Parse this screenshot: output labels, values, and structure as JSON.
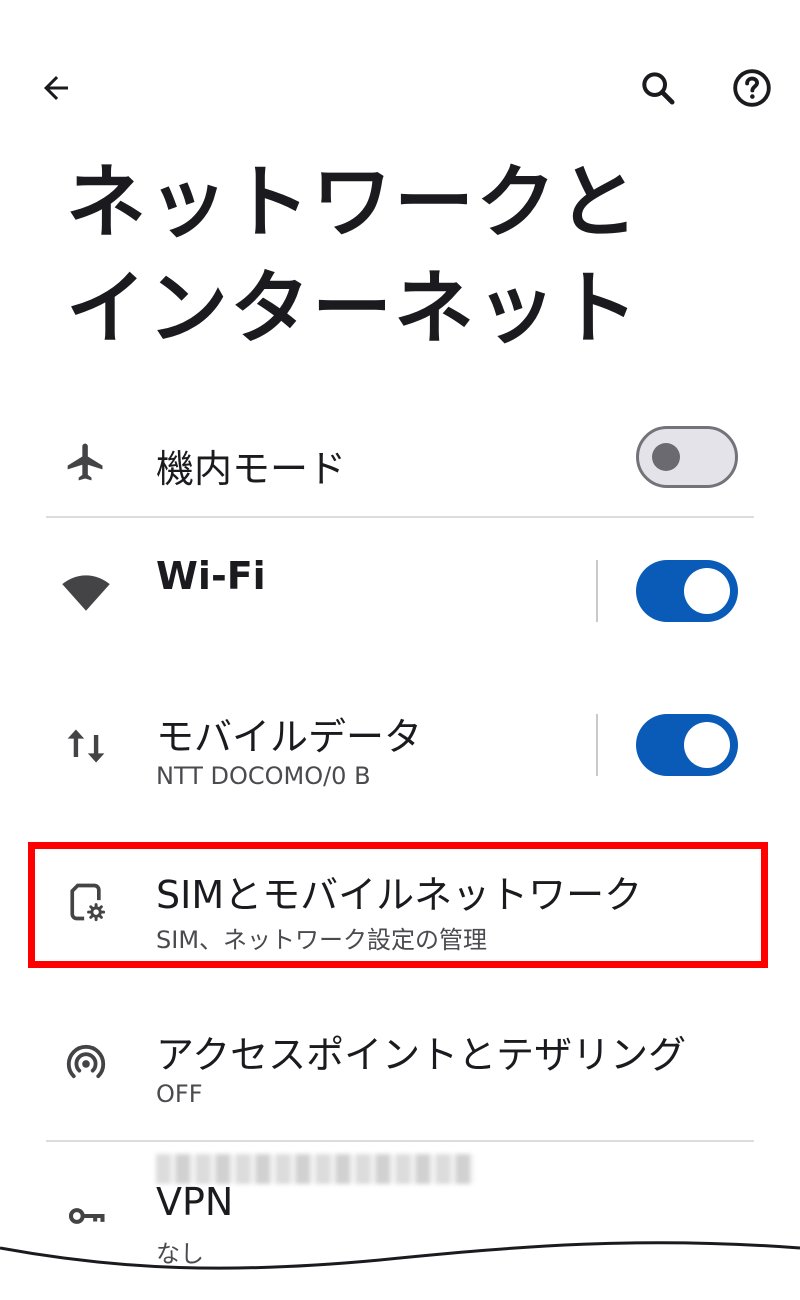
{
  "header": {
    "back_icon": "arrow-left-icon",
    "search_icon": "search-icon",
    "help_icon": "help-circle-icon"
  },
  "page": {
    "title_line1": "ネットワークと",
    "title_line2": "インターネット"
  },
  "items": [
    {
      "icon": "airplane-icon",
      "title": "機内モード",
      "toggle": "off"
    },
    {
      "icon": "wifi-icon",
      "title": "Wi-Fi",
      "subtitle_redacted": true,
      "toggle": "on"
    },
    {
      "icon": "mobile-data-icon",
      "title": "モバイルデータ",
      "subtitle": "NTT DOCOMO/0 B",
      "toggle": "on"
    },
    {
      "icon": "sim-settings-icon",
      "title": "SIMとモバイルネットワーク",
      "subtitle": "SIM、ネットワーク設定の管理",
      "highlighted": true
    },
    {
      "icon": "hotspot-icon",
      "title": "アクセスポイントとテザリング",
      "subtitle": "OFF"
    },
    {
      "icon": "key-icon",
      "title": "VPN",
      "subtitle": "なし"
    }
  ],
  "colors": {
    "accent": "#0a5bb8",
    "highlight_border": "#ff0000",
    "text": "#1b1b1f"
  }
}
